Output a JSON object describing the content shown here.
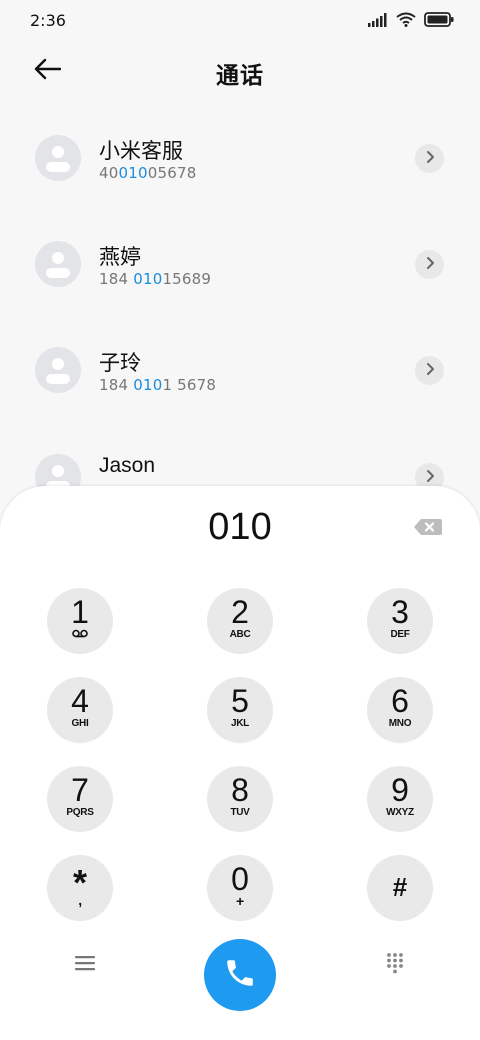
{
  "status_bar": {
    "time": "2:36"
  },
  "header": {
    "title": "通话"
  },
  "contacts": [
    {
      "name": "小米客服",
      "number_pre": "40",
      "number_match": "010",
      "number_post": "05678"
    },
    {
      "name": "燕婷",
      "number_pre": "184 ",
      "number_match": "010",
      "number_post": "15689"
    },
    {
      "name": "子玲",
      "number_pre": "184 ",
      "number_match": "010",
      "number_post": "1 5678"
    },
    {
      "name": "Jason",
      "number_pre": "",
      "number_match": "",
      "number_post": ""
    }
  ],
  "dialer": {
    "display": "010",
    "keys": [
      {
        "digit": "1",
        "letters": ""
      },
      {
        "digit": "2",
        "letters": "ABC"
      },
      {
        "digit": "3",
        "letters": "DEF"
      },
      {
        "digit": "4",
        "letters": "GHI"
      },
      {
        "digit": "5",
        "letters": "JKL"
      },
      {
        "digit": "6",
        "letters": "MNO"
      },
      {
        "digit": "7",
        "letters": "PQRS"
      },
      {
        "digit": "8",
        "letters": "TUV"
      },
      {
        "digit": "9",
        "letters": "WXYZ"
      },
      {
        "digit": "*",
        "letters": ","
      },
      {
        "digit": "0",
        "letters": "+"
      },
      {
        "digit": "#",
        "letters": ""
      }
    ]
  },
  "colors": {
    "accent": "#1e9bf0",
    "match_highlight": "#1a8ddb"
  },
  "icons": [
    "signal-icon",
    "wifi-icon",
    "battery-icon",
    "back-arrow-icon",
    "chevron-right-icon",
    "backspace-icon",
    "voicemail-icon",
    "menu-icon",
    "phone-icon",
    "keypad-icon"
  ]
}
